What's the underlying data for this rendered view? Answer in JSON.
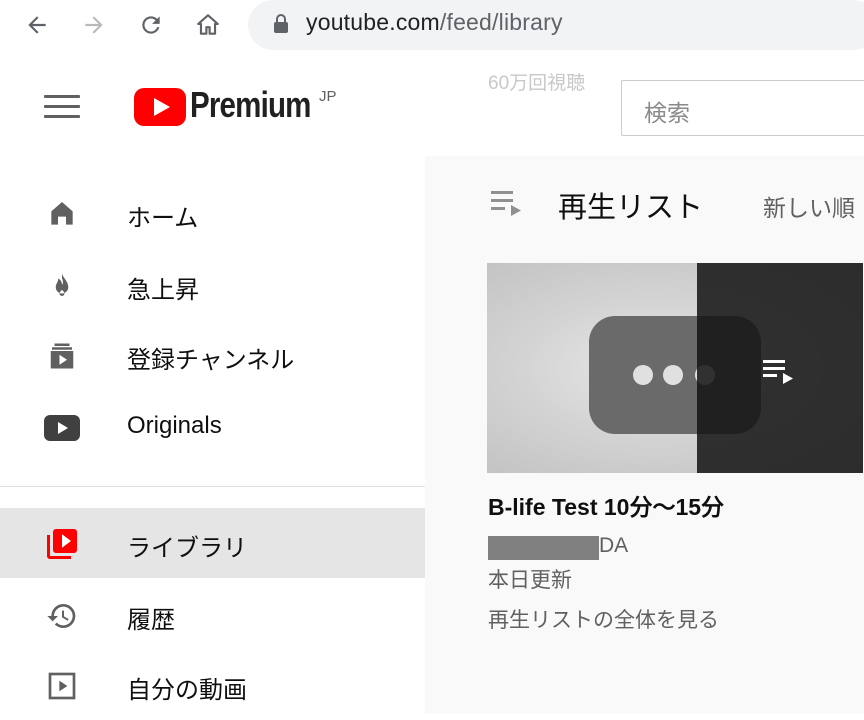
{
  "browser": {
    "url_domain": "youtube.com",
    "url_path": "/feed/library"
  },
  "masthead": {
    "logo_text": "Premium",
    "region_badge": "JP",
    "ghost_text": "60万回視聴",
    "search_placeholder": "検索"
  },
  "sidebar": {
    "items": [
      {
        "label": "ホーム",
        "icon": "home-icon"
      },
      {
        "label": "急上昇",
        "icon": "fire-icon"
      },
      {
        "label": "登録チャンネル",
        "icon": "subscriptions-icon"
      },
      {
        "label": "Originals",
        "icon": "originals-icon"
      },
      {
        "label": "ライブラリ",
        "icon": "library-icon",
        "active": true
      },
      {
        "label": "履歴",
        "icon": "history-icon"
      },
      {
        "label": "自分の動画",
        "icon": "your-videos-icon"
      }
    ]
  },
  "main": {
    "section_title": "再生リスト",
    "sort_label": "新しい順",
    "playlist": {
      "title": "B-life Test 10分〜15分",
      "channel_suffix": "DA",
      "updated": "本日更新",
      "view_all": "再生リストの全体を見る"
    }
  },
  "colors": {
    "brand_red": "#ff0000",
    "active_bg": "#e5e5e5",
    "text_secondary": "#606060"
  }
}
